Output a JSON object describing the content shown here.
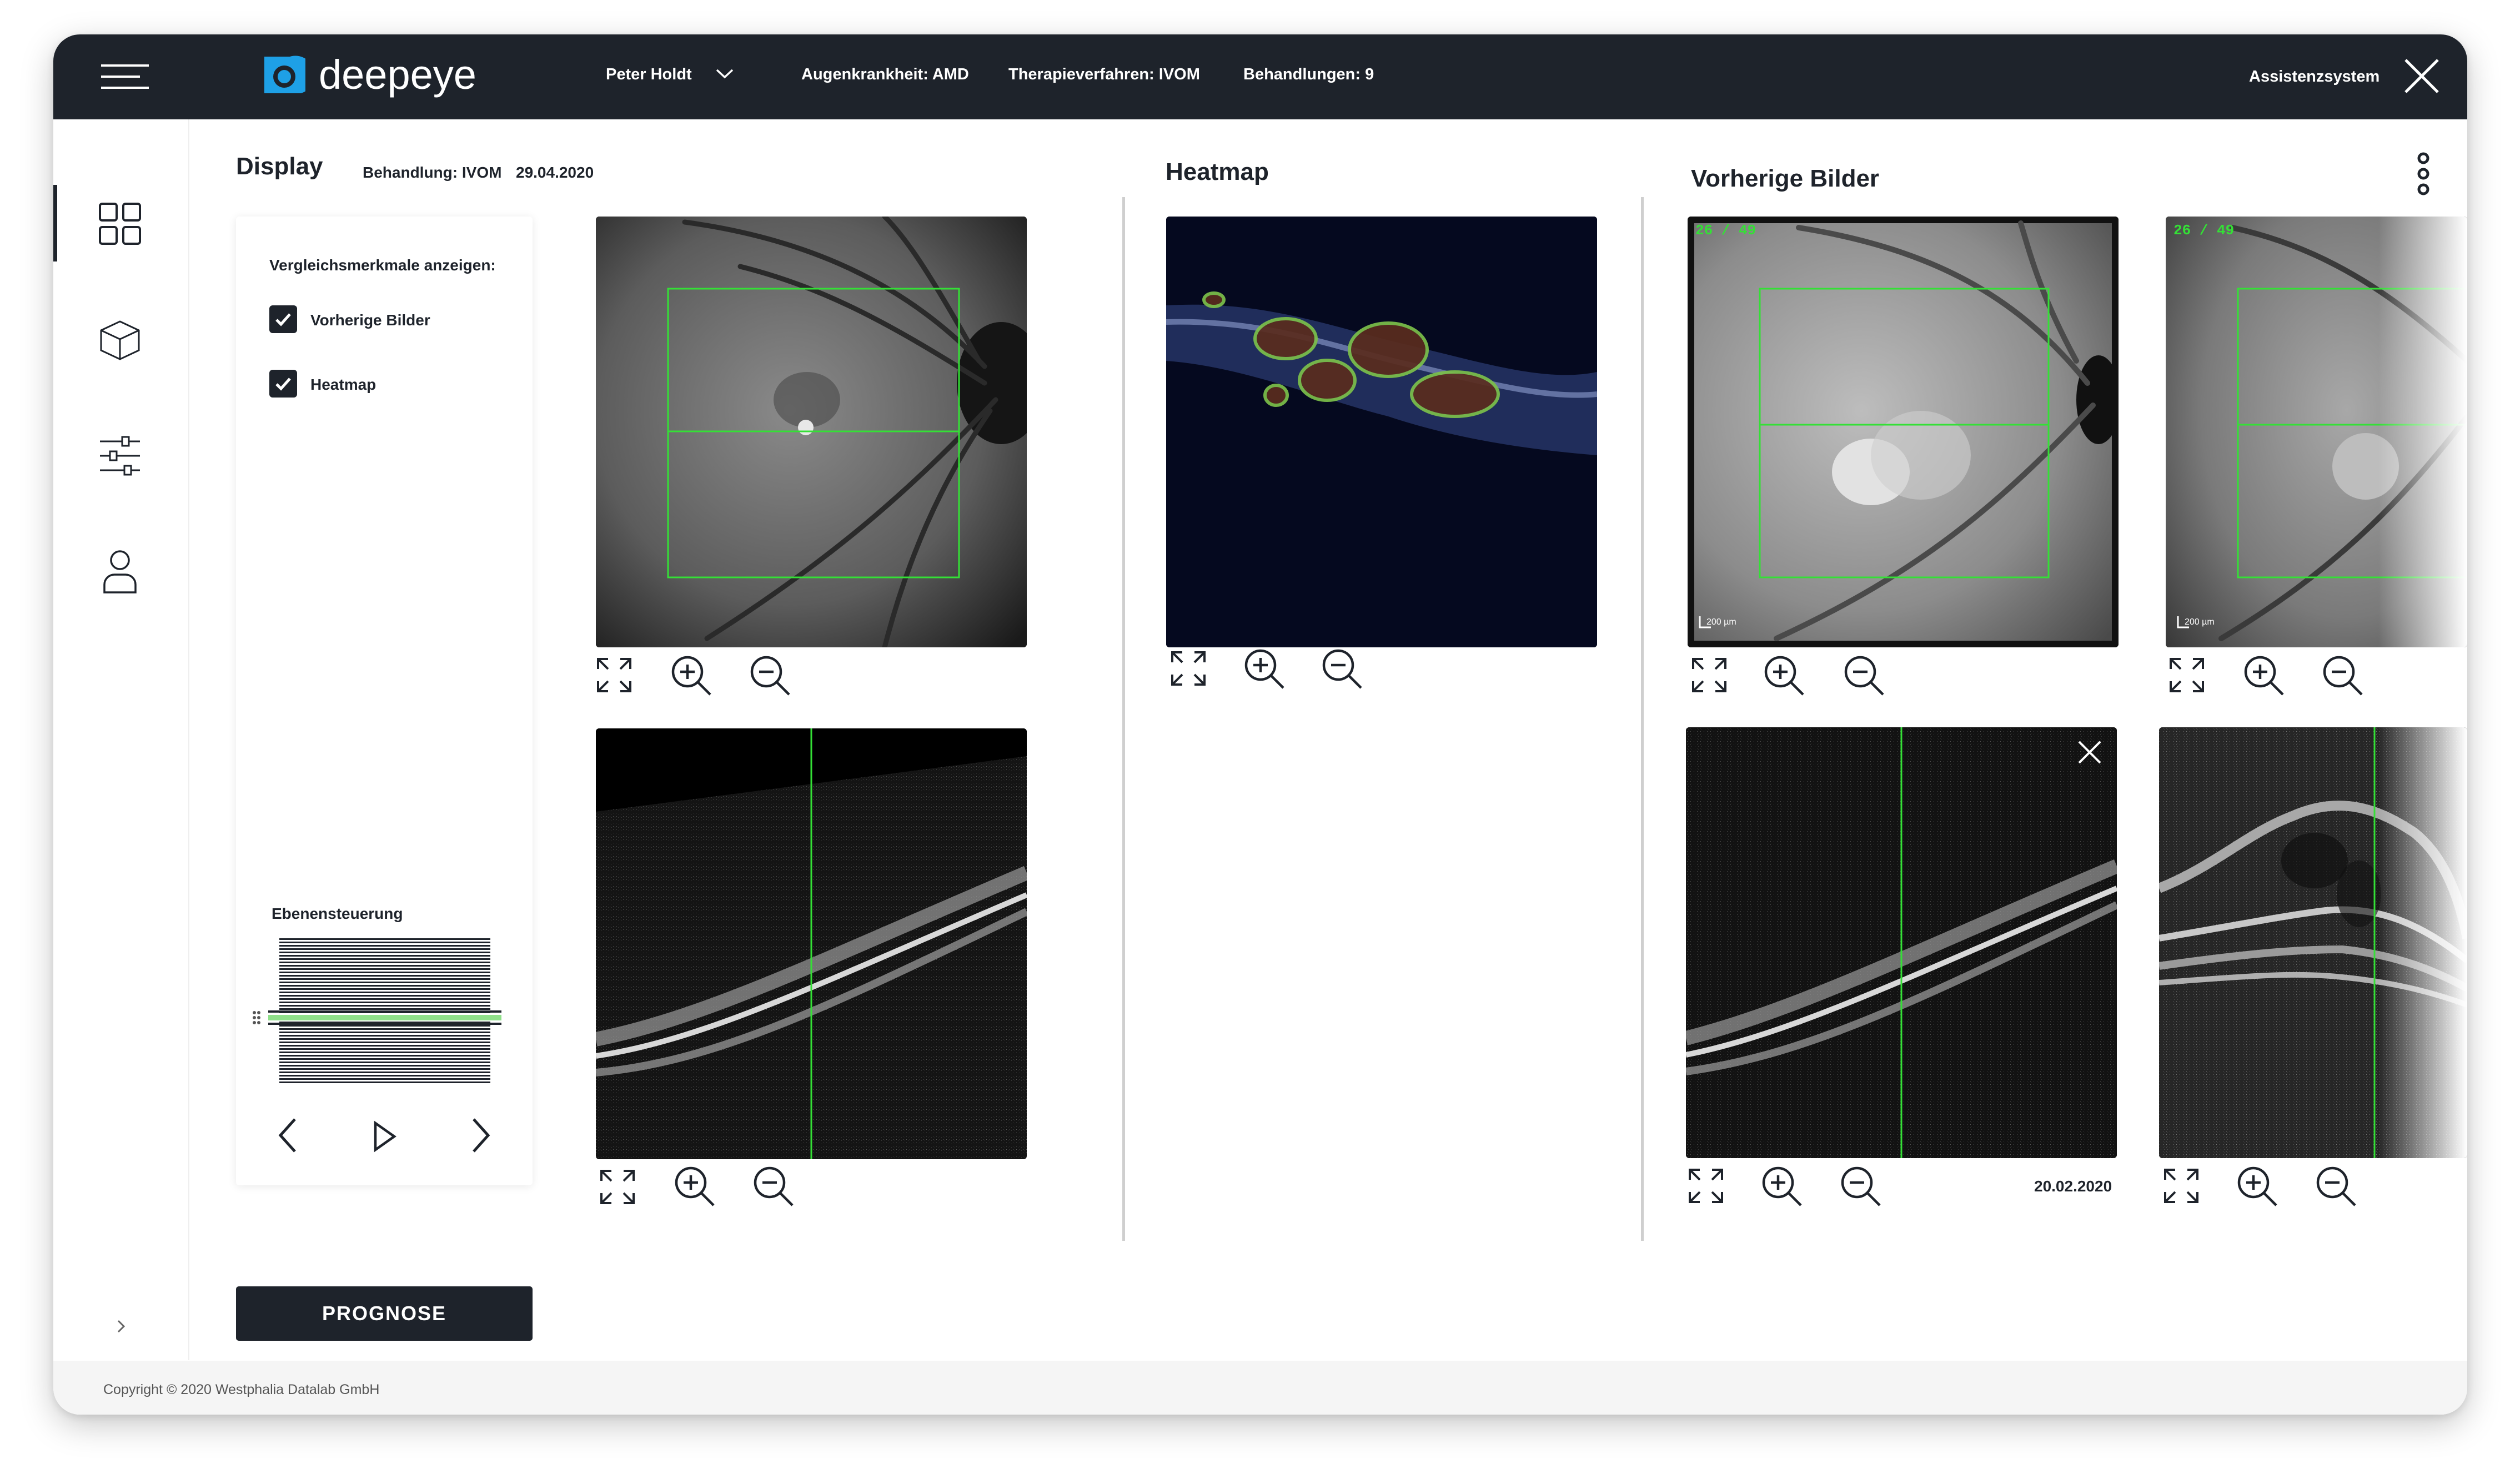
{
  "app": {
    "brand": "deepeye",
    "patient": "Peter Holdt",
    "disease": "Augenkrankheit: AMD",
    "therapy": "Therapieverfahren: IVOM",
    "treatments": "Behandlungen: 9",
    "assistant": "Assistenzsystem"
  },
  "sidebar": {
    "items": [
      {
        "icon": "grid-icon",
        "active": true
      },
      {
        "icon": "cube-icon",
        "active": false
      },
      {
        "icon": "sliders-icon",
        "active": false
      },
      {
        "icon": "user-icon",
        "active": false
      }
    ],
    "expand_icon": "chevron-right-icon"
  },
  "display": {
    "title": "Display",
    "treatment": "Behandlung: IVOM",
    "date": "29.04.2020"
  },
  "comparison": {
    "heading": "Vergleichsmerkmale anzeigen:",
    "options": [
      {
        "label": "Vorherige Bilder",
        "checked": true
      },
      {
        "label": "Heatmap",
        "checked": true
      }
    ]
  },
  "layer_control": {
    "label": "Ebenensteuerung",
    "selected_fraction": 0.52
  },
  "heatmap": {
    "title": "Heatmap"
  },
  "previous_images": {
    "title": "Vorherige Bilder",
    "slice_counter_1": "26 / 49",
    "slice_counter_2": "26 / 49",
    "scale_label": "200 µm",
    "date": "20.02.2020"
  },
  "prognose_button": "PROGNOSE",
  "footer": {
    "copyright": "Copyright © 2020 Westphalia Datalab GmbH"
  },
  "colors": {
    "topbar": "#1e232b",
    "brand_accent": "#1ea0e6",
    "scan_line": "#34e036",
    "layer_selected": "#8fe08a"
  }
}
